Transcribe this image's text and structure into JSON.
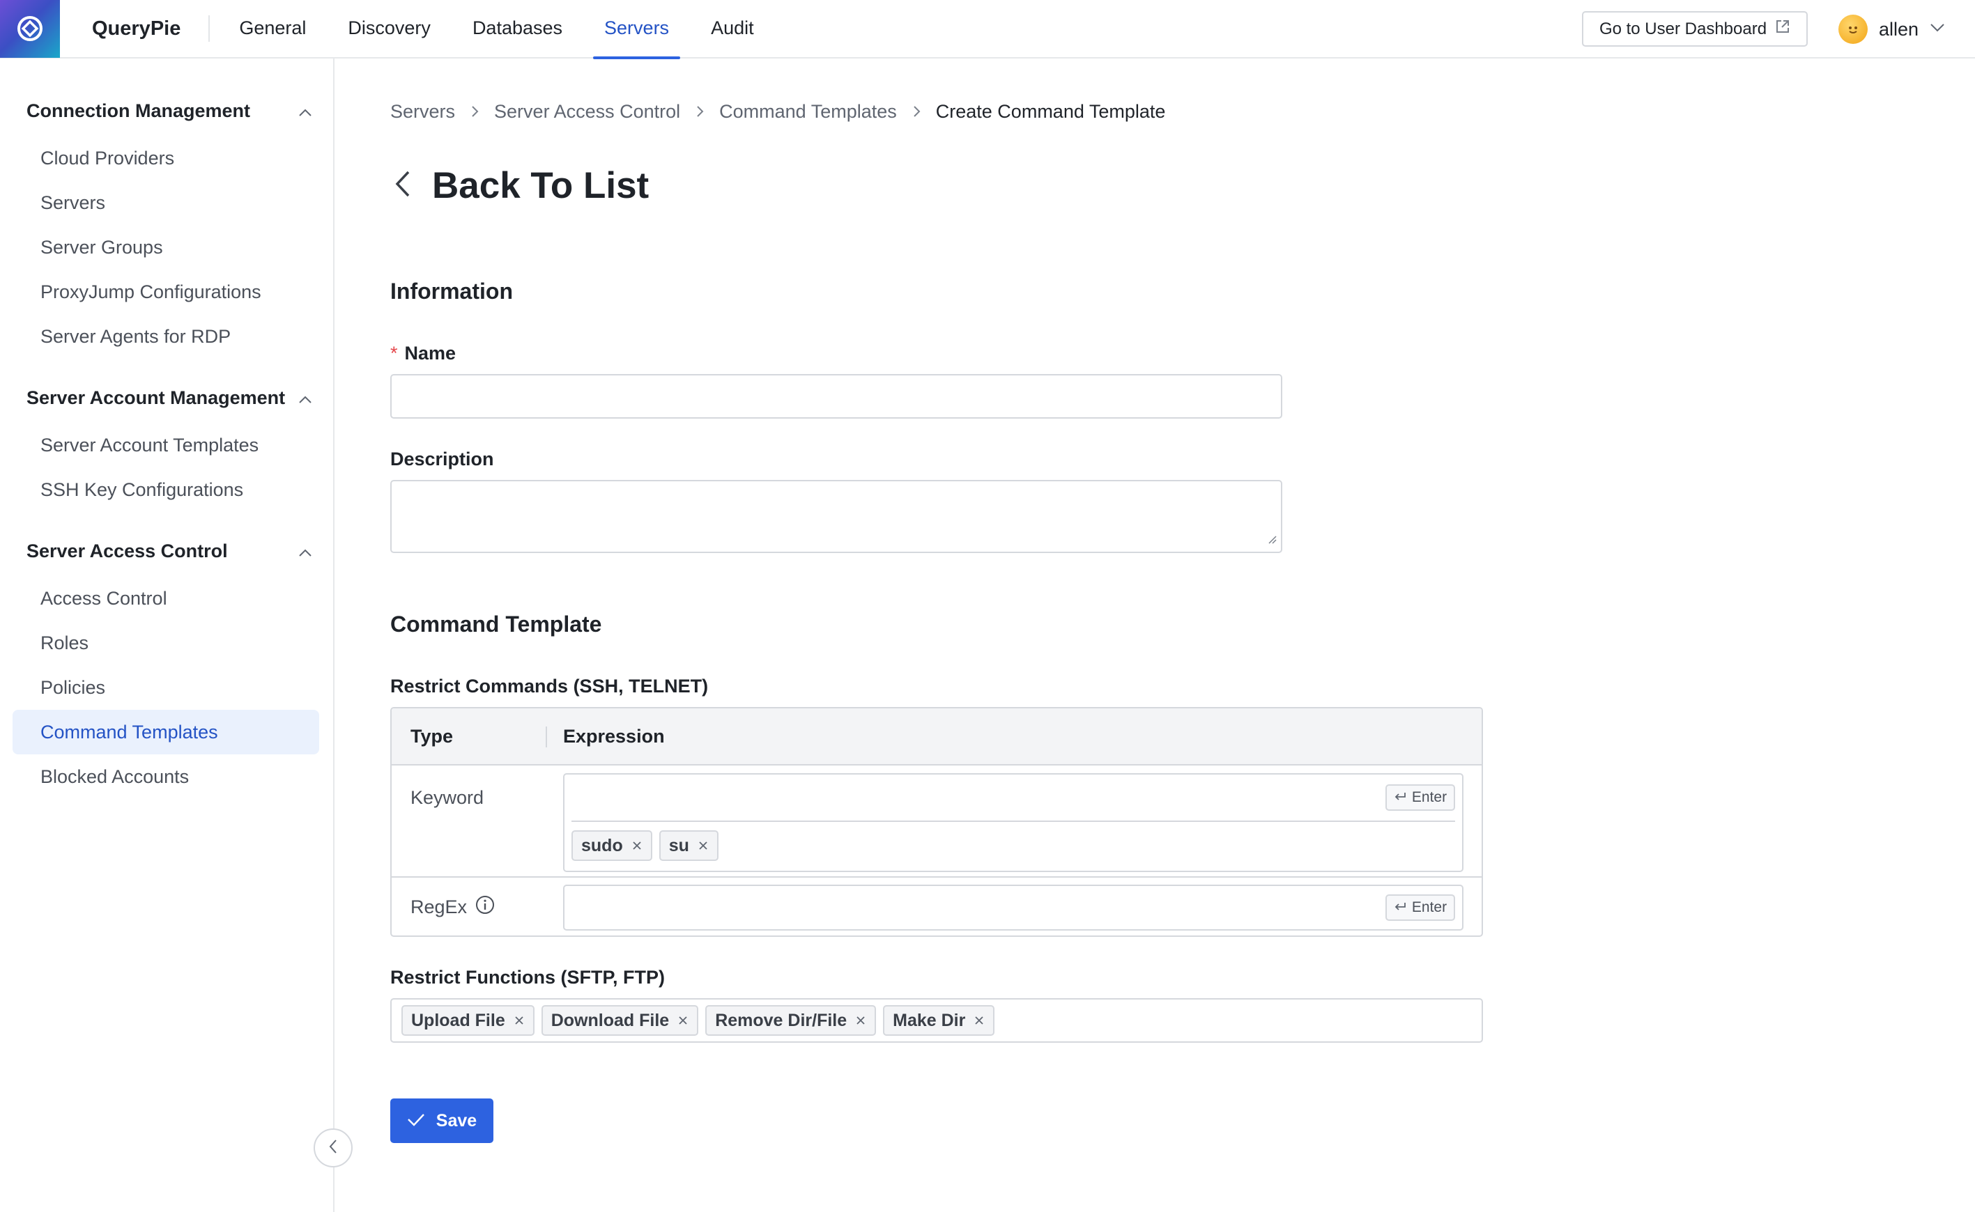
{
  "brand": {
    "name": "QueryPie"
  },
  "topnav": [
    {
      "label": "General",
      "active": false
    },
    {
      "label": "Discovery",
      "active": false
    },
    {
      "label": "Databases",
      "active": false
    },
    {
      "label": "Servers",
      "active": true
    },
    {
      "label": "Audit",
      "active": false
    }
  ],
  "header": {
    "dashboard_label": "Go to User Dashboard",
    "user_name": "allen"
  },
  "sidebar": {
    "groups": [
      {
        "title": "Connection Management",
        "items": [
          "Cloud Providers",
          "Servers",
          "Server Groups",
          "ProxyJump Configurations",
          "Server Agents for RDP"
        ]
      },
      {
        "title": "Server Account Management",
        "items": [
          "Server Account Templates",
          "SSH Key Configurations"
        ]
      },
      {
        "title": "Server Access Control",
        "items": [
          "Access Control",
          "Roles",
          "Policies",
          "Command Templates",
          "Blocked Accounts"
        ]
      }
    ],
    "active_item": "Command Templates"
  },
  "breadcrumb": [
    "Servers",
    "Server Access Control",
    "Command Templates",
    "Create Command Template"
  ],
  "page": {
    "back_label": "Back To List"
  },
  "information": {
    "section_title": "Information",
    "name_label": "Name",
    "name_required_mark": "*",
    "name_value": "",
    "description_label": "Description",
    "description_value": ""
  },
  "command_template": {
    "section_title": "Command Template",
    "restrict_commands_label": "Restrict Commands (SSH, TELNET)",
    "table_headers": {
      "type": "Type",
      "expression": "Expression"
    },
    "keyword": {
      "label": "Keyword",
      "tags": [
        "sudo",
        "su"
      ],
      "enter_hint": "Enter"
    },
    "regex": {
      "label": "RegEx",
      "enter_hint": "Enter"
    },
    "restrict_functions_label": "Restrict Functions (SFTP, FTP)",
    "function_tags": [
      "Upload File",
      "Download File",
      "Remove Dir/File",
      "Make Dir"
    ]
  },
  "actions": {
    "save_label": "Save"
  },
  "colors": {
    "accent": "#2d62e0",
    "active_bg": "#eaf1fd",
    "required": "#e5484d"
  }
}
